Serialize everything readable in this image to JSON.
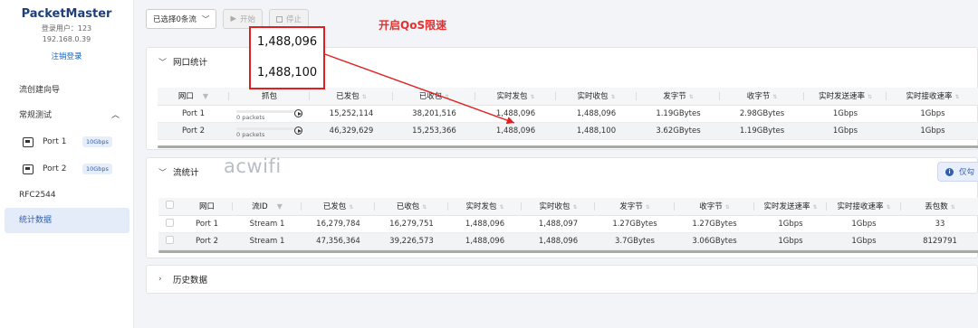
{
  "app": {
    "title": "PacketMaster",
    "user_label": "登录用户：123",
    "ip": "192.168.0.39",
    "logout": "注销登录"
  },
  "sidebar": {
    "wizard": "流创建向导",
    "regular_test": "常规测试",
    "ports": [
      {
        "label": "Port 1",
        "speed": "10Gbps"
      },
      {
        "label": "Port 2",
        "speed": "10Gbps"
      }
    ],
    "rfc": "RFC2544",
    "stats": "统计数据"
  },
  "toolbar": {
    "select": "已选择0条流",
    "start": "开始",
    "stop": "停止"
  },
  "annotation": {
    "title": "开启QoS限速",
    "value_top": "1,488,096",
    "value_bottom": "1,488,100"
  },
  "watermark": "acwifi",
  "port_stats": {
    "title": "网口统计",
    "headers": [
      "网口",
      "抓包",
      "已发包",
      "已收包",
      "实时发包",
      "实时收包",
      "发字节",
      "收字节",
      "实时发送速率",
      "实时接收速率"
    ],
    "rows": [
      {
        "port": "Port 1",
        "capture": "0 packets",
        "sent": "15,252,114",
        "recv": "38,201,516",
        "rt_sent": "1,488,096",
        "rt_recv": "1,488,096",
        "tx_bytes": "1.19GBytes",
        "rx_bytes": "2.98GBytes",
        "tx_rate": "1Gbps",
        "rx_rate": "1Gbps"
      },
      {
        "port": "Port 2",
        "capture": "0 packets",
        "sent": "46,329,629",
        "recv": "15,253,366",
        "rt_sent": "1,488,096",
        "rt_recv": "1,488,100",
        "tx_bytes": "3.62GBytes",
        "rx_bytes": "1.19GBytes",
        "tx_rate": "1Gbps",
        "rx_rate": "1Gbps"
      }
    ]
  },
  "flow_stats": {
    "title": "流统计",
    "only_button": "仅勾",
    "headers": [
      "网口",
      "流ID",
      "已发包",
      "已收包",
      "实时发包",
      "实时收包",
      "发字节",
      "收字节",
      "实时发送速率",
      "实时接收速率",
      "丢包数"
    ],
    "rows": [
      {
        "port": "Port 1",
        "flow": "Stream 1",
        "sent": "16,279,784",
        "recv": "16,279,751",
        "rt_sent": "1,488,096",
        "rt_recv": "1,488,097",
        "tx_bytes": "1.27GBytes",
        "rx_bytes": "1.27GBytes",
        "tx_rate": "1Gbps",
        "rx_rate": "1Gbps",
        "loss": "33"
      },
      {
        "port": "Port 2",
        "flow": "Stream 1",
        "sent": "47,356,364",
        "recv": "39,226,573",
        "rt_sent": "1,488,096",
        "rt_recv": "1,488,096",
        "tx_bytes": "3.7GBytes",
        "rx_bytes": "3.06GBytes",
        "tx_rate": "1Gbps",
        "rx_rate": "1Gbps",
        "loss": "8129791"
      }
    ]
  },
  "history": {
    "title": "历史数据"
  },
  "colors": {
    "brand": "#1f3f7a",
    "accent": "#2f5fb0",
    "annotation": "#e02020"
  }
}
